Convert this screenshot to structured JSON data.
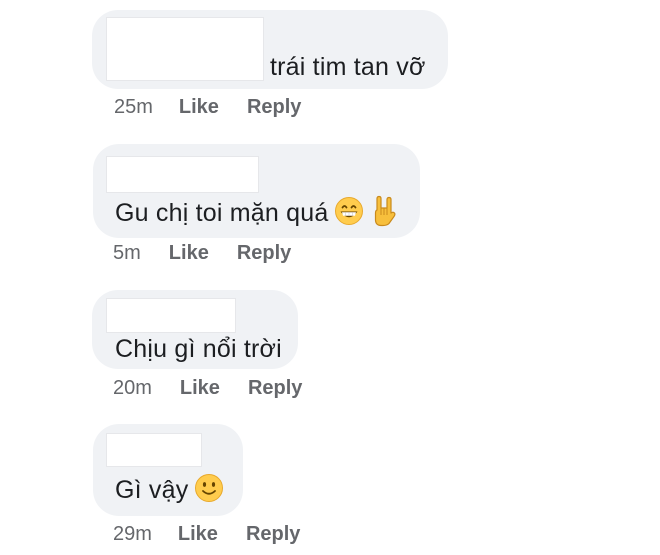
{
  "comments": [
    {
      "text": "trái tim tan vỡ",
      "time": "25m",
      "like": "Like",
      "reply": "Reply",
      "emojis": []
    },
    {
      "text": "Gu chị toi mặn quá",
      "time": "5m",
      "like": "Like",
      "reply": "Reply",
      "emojis": [
        "grinning-face-icon",
        "rock-on-hand-icon"
      ]
    },
    {
      "text": "Chịu gì nổi trời",
      "time": "20m",
      "like": "Like",
      "reply": "Reply",
      "emojis": []
    },
    {
      "text": "Gì vậy",
      "time": "29m",
      "like": "Like",
      "reply": "Reply",
      "emojis": [
        "slightly-smiling-face-icon"
      ]
    }
  ],
  "colors": {
    "bubble": "#f0f2f5",
    "text": "#1c1e21",
    "meta": "#65676b"
  }
}
